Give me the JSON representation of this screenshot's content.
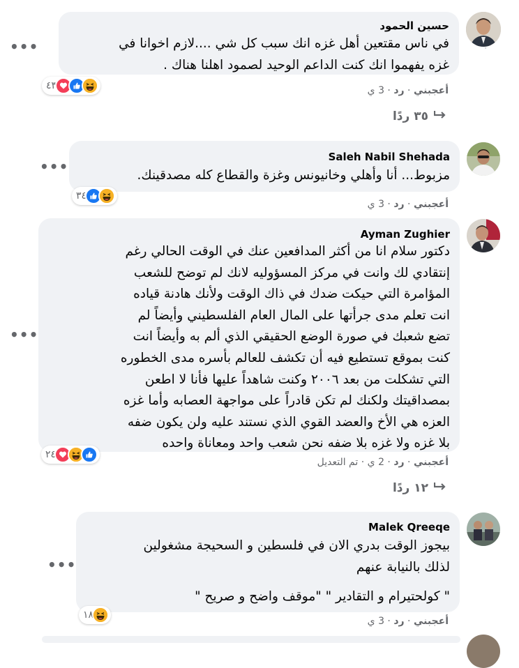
{
  "comments": [
    {
      "author": "حسين الحمود",
      "lines": [
        "في ناس مقتعين أهل غزه انك سبب كل شي ....لازم اخوانا في",
        "غزه يفهموا انك كنت الداعم الوحيد لصمود اهلنا هناك ."
      ],
      "reaction_count": "٤٣",
      "reaction_icons": [
        "haha-icon",
        "like-icon",
        "love-icon"
      ],
      "like_label": "أعجبني",
      "reply_label": "رد",
      "time": "3 ي",
      "replies_label": "٣٥ ردًا"
    },
    {
      "author": "Saleh Nabil Shehada",
      "lines": [
        "مزبوط... أنا وأهلي وخانيونس وغزة والقطاع كله مصدقينك."
      ],
      "reaction_count": "٣٤",
      "reaction_icons": [
        "haha-icon",
        "like-icon"
      ],
      "like_label": "أعجبني",
      "reply_label": "رد",
      "time": "3 ي"
    },
    {
      "author": "Ayman Zughier",
      "lines": [
        "دكتور سلام انا من أكثر المدافعين عنك في الوقت الحالي رغم",
        "إنتقادي لك وانت في مركز المسؤوليه لانك لم توضح للشعب",
        "المؤامرة التي حيكت ضدك في ذاك الوقت ولأنك هادنة قياده",
        "انت تعلم مدى جرأتها على المال العام الفلسطيني وأيضاً لم",
        "تضع شعبك في صورة الوضع الحقيقي الذي ألم به وأيضاً انت",
        "كنت بموقع تستطيع فيه أن تكشف للعالم بأسره مدى الخطوره",
        "التي تشكلت من بعد ٢٠٠٦ وكنت شاهداً عليها فأنا لا اطعن",
        "بمصداقيتك ولكنك لم تكن قادراً على مواجهة العصابه وأما غزه",
        "العزه هي الأخ والعضد القوي الذي نستند عليه ولن يكون ضفه",
        "بلا غزه ولا غزه بلا ضفه نحن شعب واحد ومعاناة واحده"
      ],
      "reaction_count": "٢٤",
      "reaction_icons": [
        "like-icon",
        "haha-icon",
        "love-icon"
      ],
      "like_label": "أعجبني",
      "reply_label": "رد",
      "time": "2 ي",
      "edited_label": "تم التعديل",
      "replies_label": "١٢ ردًا"
    },
    {
      "author": "Malek Qreeqe",
      "lines": [
        "بيجوز الوقت بدري الان في فلسطين و السحيجة مشغولين",
        "لذلك بالنيابة عنهم",
        "",
        "\" كولحتيرام و التقادير \" \"موقف واضح و صريح \""
      ],
      "reaction_count": "١٨",
      "reaction_icons": [
        "haha-icon"
      ],
      "like_label": "أعجبني",
      "reply_label": "رد",
      "time": "3 ي"
    }
  ],
  "colors": {
    "bubble_bg": "#f0f2f5",
    "like": "#1877f2",
    "love": "#f33e58",
    "haha": "#f7b125",
    "meta": "#65676b"
  }
}
